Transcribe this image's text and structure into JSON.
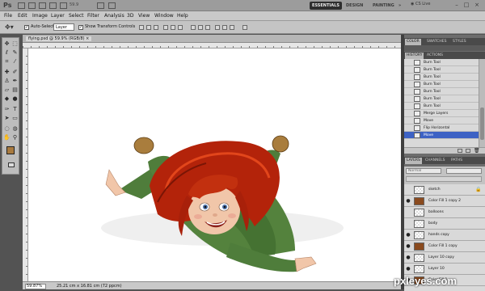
{
  "app": {
    "logo": "Ps",
    "zoom_display": "59.9"
  },
  "workspaces": [
    "ESSENTIALS",
    "DESIGN",
    "PAINTING",
    "»"
  ],
  "cslive": "CS Live",
  "window_controls": [
    "–",
    "□",
    "×"
  ],
  "menu": [
    "File",
    "Edit",
    "Image",
    "Layer",
    "Select",
    "Filter",
    "Analysis",
    "3D",
    "View",
    "Window",
    "Help"
  ],
  "options": {
    "auto_select_label": "Auto-Select:",
    "auto_select_value": "Layer",
    "show_transform_label": "Show Transform Controls"
  },
  "document": {
    "tab_title": "flying.psd @ 59.9% (RGB/8) ×",
    "status_zoom": "59.87%",
    "status_doc": "25.21 cm x 16.81 cm (72 ppcm)"
  },
  "colors": {
    "foreground": "#a87a3f",
    "background": "#ffffff",
    "selection": "#3d62c4"
  },
  "color_panel_tabs": [
    "COLOR",
    "SWATCHES",
    "STYLES"
  ],
  "history_panel_tabs": [
    "HISTORY",
    "ACTIONS"
  ],
  "history": [
    {
      "label": "Burn Tool",
      "selected": false
    },
    {
      "label": "Burn Tool",
      "selected": false
    },
    {
      "label": "Burn Tool",
      "selected": false
    },
    {
      "label": "Burn Tool",
      "selected": false
    },
    {
      "label": "Burn Tool",
      "selected": false
    },
    {
      "label": "Burn Tool",
      "selected": false
    },
    {
      "label": "Burn Tool",
      "selected": false
    },
    {
      "label": "Merge Layers",
      "selected": false
    },
    {
      "label": "Move",
      "selected": false
    },
    {
      "label": "Flip Horizontal",
      "selected": false
    },
    {
      "label": "Move",
      "selected": true
    }
  ],
  "layers_panel_tabs": [
    "LAYERS",
    "CHANNELS",
    "PATHS"
  ],
  "layers_blend_mode": "Normal",
  "layers": [
    {
      "name": "sketch",
      "visible": false,
      "locked": true,
      "fill": false
    },
    {
      "name": "Color Fill 1 copy 2",
      "visible": true,
      "locked": false,
      "fill": true
    },
    {
      "name": "balloons",
      "visible": false,
      "locked": false,
      "fill": false
    },
    {
      "name": "body",
      "visible": false,
      "locked": false,
      "fill": false
    },
    {
      "name": "hands copy",
      "visible": true,
      "locked": false,
      "fill": false
    },
    {
      "name": "Color Fill 1 copy",
      "visible": true,
      "locked": false,
      "fill": true
    },
    {
      "name": "Layer 10 copy",
      "visible": true,
      "locked": false,
      "fill": false
    },
    {
      "name": "Layer 10",
      "visible": true,
      "locked": false,
      "fill": false
    },
    {
      "name": "Color Fill 1",
      "visible": true,
      "locked": false,
      "fill": true
    }
  ],
  "watermark": "pxleyes.com"
}
